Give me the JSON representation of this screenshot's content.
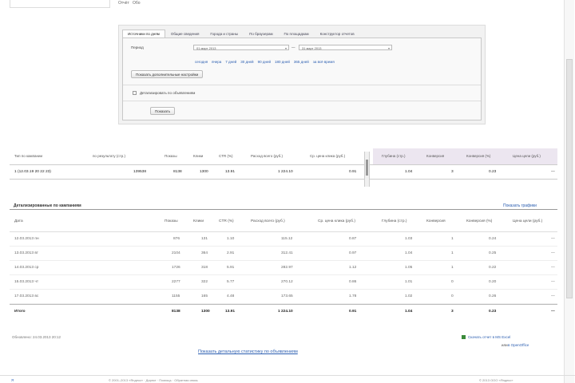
{
  "top": {
    "link_left": "Отчёт",
    "link_right": "Обо"
  },
  "tabs": [
    "Источники по дням",
    "Общие сведения",
    "Города и страны",
    "По браузерам",
    "По площадкам",
    "Конструктор отчетов"
  ],
  "filter": {
    "period_label": "Период",
    "date_from": "01 март 2013",
    "date_to": "31 март 2013",
    "dash": "—",
    "quick_ranges": [
      "сегодня",
      "вчера",
      "7 дней",
      "30 дней",
      "90 дней",
      "180 дней",
      "365 дней",
      "за всё время"
    ],
    "more_settings": "Показать дополнительные настройки",
    "checkbox_label": "Детализировать по объявлениям",
    "submit": "Показать"
  },
  "summary": {
    "headers": [
      "Тип по кампании",
      "по результату (cтр.)",
      "Показы",
      "Клики",
      "CTR (%)",
      "Расход всего (руб.)",
      "Ср. цена клика (руб.)",
      "Глубина (стр.)",
      "Конверсия",
      "Конверсия (%)",
      "Цена цели (руб.)"
    ],
    "values": [
      "1 (12.03.19 20 22 23)",
      "139538",
      "8138",
      "1300",
      "13.91",
      "1 224.10",
      "0.91",
      "1.04",
      "3",
      "0.23",
      "—"
    ]
  },
  "detail": {
    "title": "Детализированные по кампаниям",
    "link": "Показать графики",
    "headers": [
      "Дата",
      "Показы",
      "Клики",
      "CTR (%)",
      "Расход всего (руб.)",
      "Ср. цена клика (руб.)",
      "Глубина (стр.)",
      "Конверсия",
      "Конверсия (%)",
      "Цена цели (руб.)"
    ],
    "rows": [
      [
        "12.03.2013 пн",
        "876",
        "131",
        "1.10",
        "115.12",
        "0.87",
        "1.03",
        "1",
        "0.24",
        "—"
      ],
      [
        "13.03.2013 вт",
        "2104",
        "364",
        "2.91",
        "312.41",
        "0.97",
        "1.04",
        "1",
        "0.25",
        "—"
      ],
      [
        "14.03.2013 ср",
        "1726",
        "318",
        "5.91",
        "282.97",
        "1.12",
        "1.05",
        "1",
        "0.22",
        "—"
      ],
      [
        "15.03.2013 чт",
        "2277",
        "322",
        "5.77",
        "270.12",
        "0.86",
        "1.01",
        "0",
        "0.20",
        "—"
      ],
      [
        "17.03.2013 вс",
        "1155",
        "165",
        "4.48",
        "173.65",
        "1.78",
        "1.02",
        "0",
        "0.26",
        "—"
      ]
    ],
    "total": [
      "Итого",
      "8138",
      "1300",
      "13.91",
      "1 224.10",
      "0.91",
      "1.04",
      "3",
      "0.23",
      "—"
    ]
  },
  "footer": {
    "updated": "Обновлено: 24.03.2013 20:12",
    "export": "Скачать отчет в MS Excel",
    "export_sub": "или",
    "export_sub2": "в OpenOffice",
    "bigger_link": "Показать детальную статистику по объявлениям",
    "logo": "Я",
    "text": "© 2001–2013 «Яндекс» · Директ · Помощь · Обратная связь",
    "copyright": "© 2013 ООО «Яндекс»"
  },
  "colors": {
    "accent": "#2a5db0",
    "shade": "#ece6f0",
    "panel": "#f2f2f2"
  }
}
